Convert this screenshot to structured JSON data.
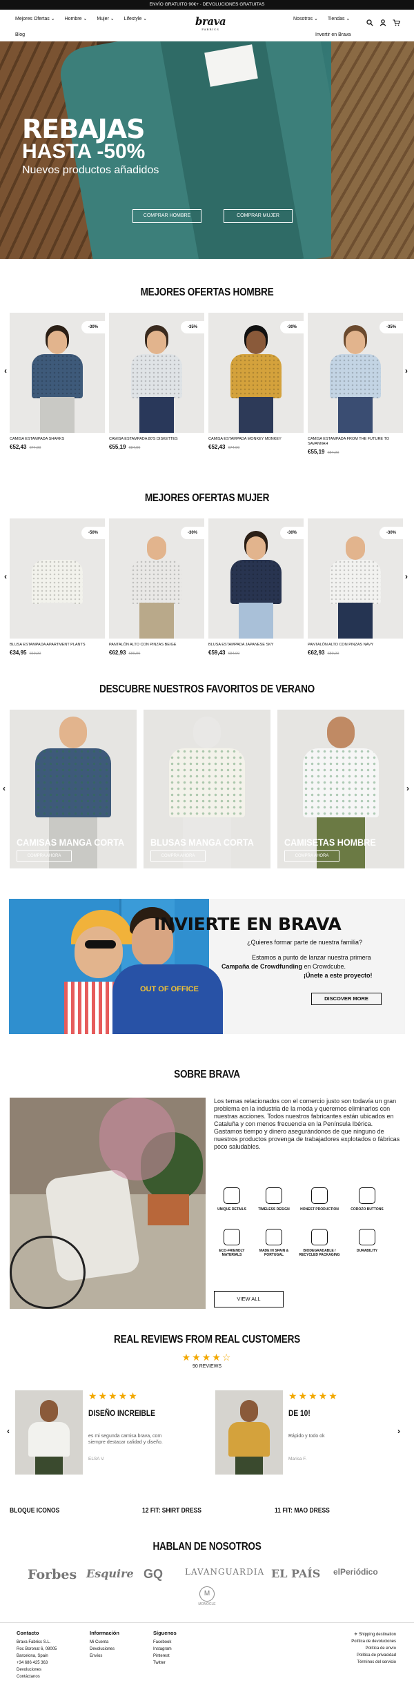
{
  "topbar": {
    "text": "ENVÍO GRATUITO 90€+ · DEVOLUCIONES GRATUITAS"
  },
  "nav": {
    "left": [
      "Mejores Ofertas",
      "Hombre",
      "Mujer",
      "Lifestyle"
    ],
    "right": [
      "Nosotros",
      "Tiendas"
    ],
    "blog": "Blog",
    "invest": "Invertir en Brava",
    "logo": "brava",
    "logo_sub": "FABRICS"
  },
  "hero": {
    "title1": "REBAJAS",
    "title2": "HASTA -50%",
    "subtitle": "Nuevos productos añadidos",
    "btn_men": "COMPRAR HOMBRE",
    "btn_women": "COMPRAR MUJER"
  },
  "men": {
    "title": "MEJORES OFERTAS HOMBRE",
    "items": [
      {
        "name": "CAMISA ESTAMPADA SHARKS",
        "price": "€52,43",
        "old": "€74,90",
        "badge": "-30%",
        "shirt": "#3e5a7a",
        "skin": "#e2b48d",
        "hair": "#2b1f16",
        "pants": "#c9c9c5"
      },
      {
        "name": "CAMISA ESTAMPADA 80'S DISKETTES",
        "price": "€55,19",
        "old": "€84,90",
        "badge": "-35%",
        "shirt": "#dfe3e6",
        "skin": "#e2b48d",
        "hair": "#3a2b1f",
        "pants": "#29385a"
      },
      {
        "name": "CAMISA ESTAMPADA MONKEY MONKEY",
        "price": "€52,43",
        "old": "€74,90",
        "badge": "-30%",
        "shirt": "#d4a23c",
        "skin": "#8a5a3a",
        "hair": "#111",
        "pants": "#2d3a58"
      },
      {
        "name": "CAMISA ESTAMPADA FROM THE FUTURE TO SAVANNAH",
        "price": "€55,19",
        "old": "€84,90",
        "badge": "-35%",
        "shirt": "#c3d4e4",
        "skin": "#e2b48d",
        "hair": "#6b4a2e",
        "pants": "#3a4d72"
      }
    ]
  },
  "women": {
    "title": "MEJORES OFERTAS MUJER",
    "items": [
      {
        "name": "BLUSA ESTAMPADA APARTMENT PLANTS",
        "price": "€34,95",
        "old": "€69,90",
        "badge": "-50%",
        "shirt": "#f2f2ec",
        "skin": "#e9e8e6",
        "hair": "#e9e8e6",
        "pants": "#e9e8e6"
      },
      {
        "name": "PANTALÓN ALTO CON PINZAS BEIGE",
        "price": "€62,93",
        "old": "€89,90",
        "badge": "-30%",
        "shirt": "#e9e8e6",
        "skin": "#e2b48d",
        "hair": "#e9e8e6",
        "pants": "#b9a98a"
      },
      {
        "name": "BLUSA ESTAMPADA JAPANESE SKY",
        "price": "€59,43",
        "old": "€84,90",
        "badge": "-30%",
        "shirt": "#283450",
        "skin": "#e2b48d",
        "hair": "#2b1f16",
        "pants": "#a9c0d8"
      },
      {
        "name": "PANTALÓN ALTO CON PINZAS NAVY",
        "price": "€62,93",
        "old": "€89,90",
        "badge": "-30%",
        "shirt": "#f2f2f0",
        "skin": "#e2b48d",
        "hair": "#e9e8e6",
        "pants": "#253452"
      }
    ]
  },
  "fav": {
    "title": "DESCUBRE NUESTROS FAVORITOS DE VERANO",
    "items": [
      {
        "label": "CAMISAS MANGA CORTA",
        "btn": "COMPRA AHORA",
        "shirt": "#3e5a7a",
        "skin": "#e2b48d",
        "pants": "#c9c9c5"
      },
      {
        "label": "BLUSAS MANGA CORTA",
        "btn": "COMPRA AHORA",
        "shirt": "#f3f2ea",
        "skin": "#e9e8e6",
        "pants": "#e9e8e6"
      },
      {
        "label": "CAMISETAS HOMBRE",
        "btn": "COMPRA AHORA",
        "shirt": "#f6f6f6",
        "skin": "#c08a64",
        "pants": "#6b7a44"
      }
    ]
  },
  "invest": {
    "title": "INVIERTE EN BRAVA",
    "q": "¿Quieres formar parte de nuestra familia?",
    "p1": "Estamos a punto de lanzar nuestra primera",
    "p2": "Campaña de Crowdfunding",
    "p3": "en Crowdcube.",
    "p4": "¡Únete a este proyecto!",
    "btn": "DISCOVER MORE",
    "sweater_text": "OUT OF OFFICE"
  },
  "about": {
    "title": "SOBRE BRAVA",
    "text": "Los temas relacionados con el comercio justo son todavía un gran problema en la industria de la moda y queremos eliminarlos con nuestras acciones. Todos nuestros fabricantes están ubicados en Cataluña y con menos frecuencia en la Península Ibérica. Gastamos tiempo y dinero asegurándonos de que ninguno de nuestros productos provenga de trabajadores explotados o fábricas poco saludables.",
    "features": [
      "UNIQUE DETAILS",
      "TIMELESS DESIGN",
      "HONEST PRODUCTION",
      "COROZO BUTTONS",
      "ECO-FRIENDLY MATERIALS",
      "MADE IN SPAIN & PORTUGAL",
      "BIODEGRADABLE / RECYCLED PACKAGING",
      "DURABILITY"
    ],
    "btn": "VIEW ALL"
  },
  "reviews": {
    "title": "REAL REVIEWS FROM REAL CUSTOMERS",
    "stars": "★★★★☆",
    "count": "90 REVIEWS",
    "items": [
      {
        "title": "DISEÑO INCREIBLE",
        "text": "es mi segunda camisa brava, com siempre destacar calidad y diseño.",
        "author": "ELSA V.",
        "stars": "★★★★★",
        "shirt": "#f2f2ee",
        "skin": "#8a5a3a"
      },
      {
        "title": "DE 10!",
        "text": "Rápido y todo ok",
        "author": "Marisa F.",
        "stars": "★★★★★",
        "shirt": "#d4a23c",
        "skin": "#8a5a3a"
      }
    ]
  },
  "products_row": [
    "BLOQUE ICONOS",
    "12 FIT: SHIRT DRESS",
    "11 FIT: MAO DRESS"
  ],
  "press": {
    "title": "HABLAN DE NOSOTROS",
    "brands": [
      "Forbes",
      "Esquire",
      "GQ",
      "LAVANGUARDIA",
      "EL PAÍS",
      "elPeriódico"
    ],
    "last": "MONOCLE"
  },
  "footer": {
    "contact": {
      "title": "Contacto",
      "lines": [
        "Brava Fabrics S.L.",
        "Roc Boronat 6, 08005",
        "Barcelona, Spain",
        "+34 686 425 363",
        "Devoluciones",
        "Contáctanos"
      ]
    },
    "info": {
      "title": "Información",
      "lines": [
        "Mi Cuenta",
        "Devoluciones",
        "Envíos"
      ]
    },
    "follow": {
      "title": "Síguenos",
      "lines": [
        "Facebook",
        "Instagram",
        "Pinterest",
        "Twitter"
      ]
    },
    "right": [
      "Shipping destination",
      "Política de devoluciones",
      "Política de envío",
      "Política de privacidad",
      "Términos del servicio"
    ]
  }
}
